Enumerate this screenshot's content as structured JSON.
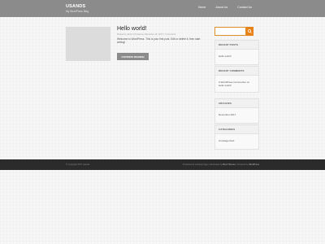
{
  "header": {
    "site_title": "USANDS",
    "tagline": "My WordPress Blog",
    "nav": [
      "Home",
      "About Us",
      "Contact Us"
    ]
  },
  "post": {
    "title": "Hello world!",
    "meta": "Posted by admin | Posted on December 16, 2017 | 1 Comment",
    "excerpt": "Welcome to WordPress. This is your first post. Edit or delete it, then start writing!",
    "read_more": "CONTINUE READING"
  },
  "search": {
    "placeholder": ""
  },
  "sidebar": {
    "recent_posts": {
      "title": "RECENT POSTS",
      "items": [
        "Hello world!"
      ]
    },
    "recent_comments": {
      "title": "RECENT COMMENTS",
      "author_line": "A WordPress Commenter on",
      "post_link": "Hello world!"
    },
    "archives": {
      "title": "ARCHIVES",
      "items": [
        "December 2017"
      ]
    },
    "categories": {
      "title": "CATEGORIES",
      "items": [
        "Uncategorized"
      ]
    }
  },
  "footer": {
    "copyright": "© Copyright 2017 usands",
    "credit_prefix": "Professional Landing Page | Developed by",
    "credit_theme": "Best Themes",
    "credit_middle": "| Powered by",
    "credit_wp": "WordPress"
  },
  "colors": {
    "header": "#8b8b8b",
    "accent": "#e8821a",
    "footer": "#2b2b2b"
  }
}
